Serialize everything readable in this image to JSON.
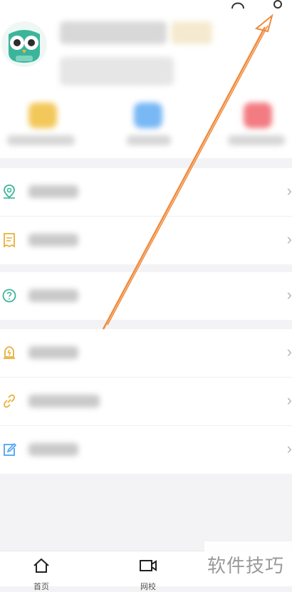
{
  "header": {
    "top_icons": [
      "headset-icon",
      "gear-icon"
    ]
  },
  "colors": {
    "accent_orange": "#f08a3c",
    "teal": "#3bb59a",
    "gold": "#e8b13a",
    "blue": "#4aa3ee"
  },
  "menu_groups": [
    [
      {
        "icon": "location-pin-icon"
      },
      {
        "icon": "receipt-icon"
      }
    ],
    [
      {
        "icon": "help-icon"
      }
    ],
    [
      {
        "icon": "alarm-icon"
      },
      {
        "icon": "link-icon"
      },
      {
        "icon": "edit-icon"
      }
    ]
  ],
  "tabbar": {
    "home_label": "首页",
    "video_label": "网校"
  },
  "watermark": "软件技巧"
}
